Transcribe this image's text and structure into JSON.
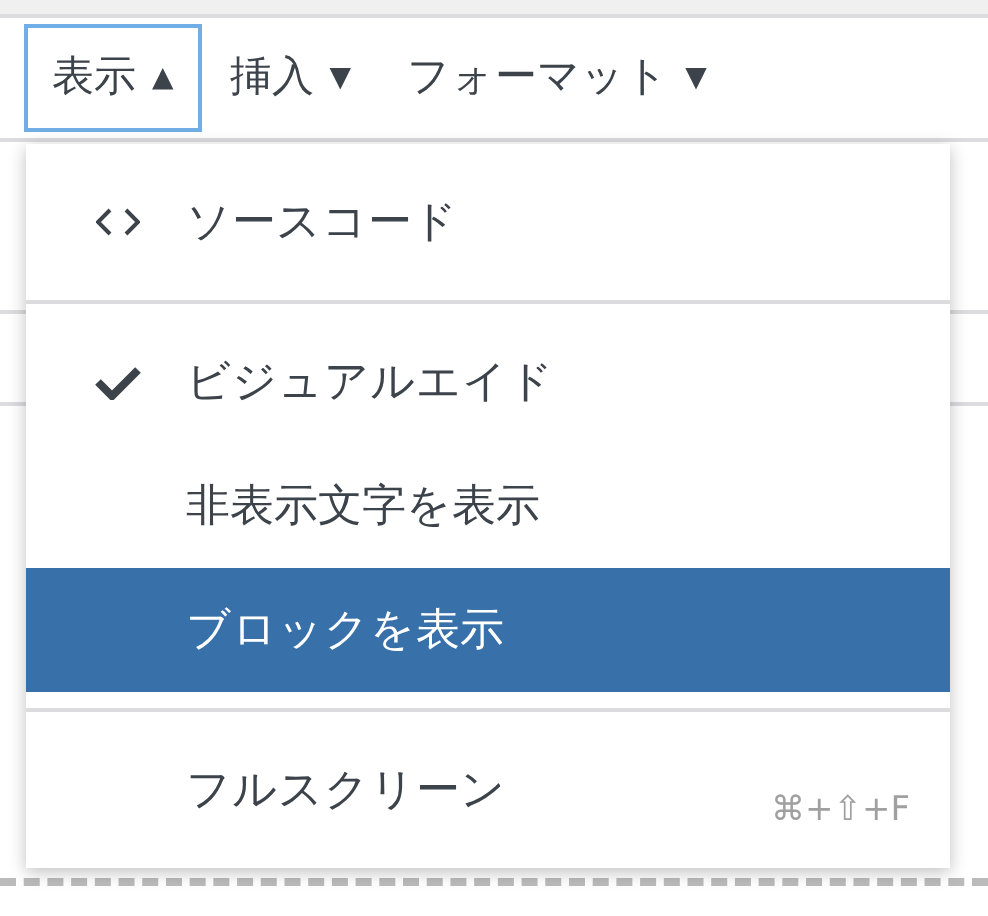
{
  "menubar": [
    {
      "label": "表示",
      "arrow": "▲",
      "selected": true
    },
    {
      "label": "挿入",
      "arrow": "▼",
      "selected": false
    },
    {
      "label": "フォーマット",
      "arrow": "▼",
      "selected": false
    }
  ],
  "menu": {
    "groups": [
      [
        {
          "kind": "code",
          "label": "ソースコード",
          "selected": false
        }
      ],
      [
        {
          "kind": "toggle",
          "label": "ビジュアルエイド",
          "checked": true,
          "selected": false
        },
        {
          "kind": "toggle",
          "label": "非表示文字を表示",
          "checked": false,
          "selected": false
        },
        {
          "kind": "toggle",
          "label": "ブロックを表示",
          "checked": false,
          "selected": true
        }
      ],
      [
        {
          "kind": "plain",
          "label": "フルスクリーン",
          "shortcut": "⌘+⇧+F",
          "selected": false
        }
      ]
    ]
  }
}
